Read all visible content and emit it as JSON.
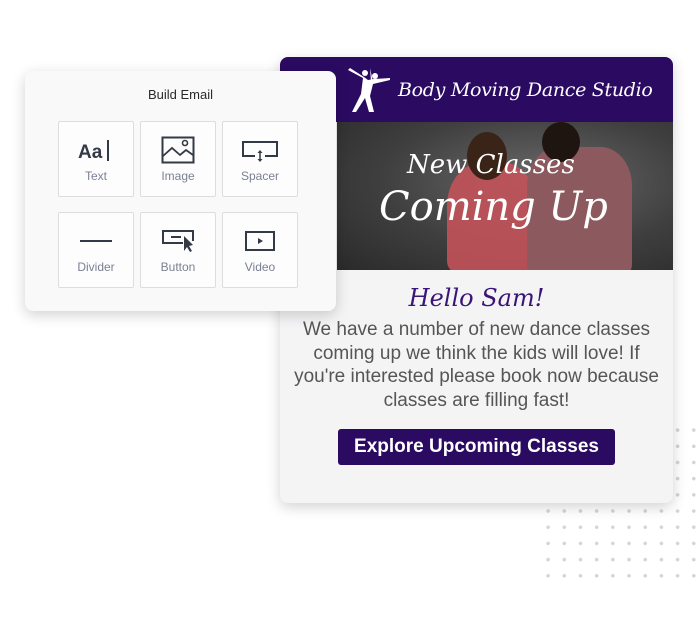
{
  "build_panel": {
    "title": "Build Email",
    "tiles": [
      {
        "label": "Text",
        "icon": "text-icon",
        "glyph": "Aa"
      },
      {
        "label": "Image",
        "icon": "image-icon"
      },
      {
        "label": "Spacer",
        "icon": "spacer-icon"
      },
      {
        "label": "Divider",
        "icon": "divider-icon"
      },
      {
        "label": "Button",
        "icon": "button-icon"
      },
      {
        "label": "Video",
        "icon": "video-icon"
      }
    ]
  },
  "email": {
    "studio_name": "Body Moving Dance Studio",
    "hero_line1": "New Classes",
    "hero_line2": "Coming Up",
    "greeting": "Hello Sam!",
    "message": "We have a number of new dance classes coming up we think the kids will love! If you're interested please book now because classes are filling fast!",
    "cta_label": "Explore Upcoming Classes"
  },
  "colors": {
    "brand_purple": "#2b0a62",
    "greeting_purple": "#3a1577",
    "tile_label": "#7a8192"
  }
}
